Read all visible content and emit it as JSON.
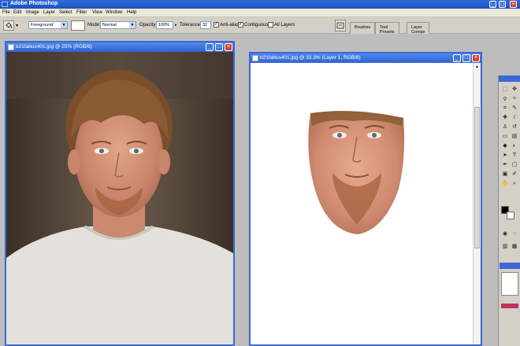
{
  "app": {
    "title": "Adobe Photoshop",
    "window_buttons": {
      "minimize": "_",
      "maximize": "□",
      "close": "×"
    }
  },
  "menu": [
    "File",
    "Edit",
    "Image",
    "Layer",
    "Select",
    "Filter",
    "View",
    "Window",
    "Help"
  ],
  "options": {
    "fill_source": "Foreground",
    "mode_label": "Mode:",
    "mode_value": "Normal",
    "opacity_label": "Opacity:",
    "opacity_value": "100%",
    "tolerance_label": "Tolerance:",
    "tolerance_value": "32",
    "anti_alias_label": "Anti-alias",
    "anti_alias_checked": true,
    "contiguous_label": "Contiguous",
    "contiguous_checked": true,
    "all_layers_label": "All Layers",
    "all_layers_checked": false
  },
  "palette_tabs": [
    "Brushes",
    "Tool Presets",
    "Layer Comps"
  ],
  "documents": [
    {
      "title": "b21fabus401.jpg @ 25% (RGB/8)"
    },
    {
      "title": "b21fabus401.jpg @ 33.3% (Layer 1, RGB/8)"
    }
  ],
  "colors": {
    "title_bar": "#2f6bd9",
    "menu_bg": "#ece9d8",
    "toolbar_bg": "#d4d0c8",
    "foreground_swatch": "#000000",
    "background_swatch": "#ffffff",
    "close_button": "#d8452b"
  },
  "icons": {
    "paint_bucket": "paint-bucket-icon",
    "palette_well": "palette-well-icon",
    "toolbox_tools": [
      "marquee-icon",
      "move-icon",
      "lasso-icon",
      "magic-wand-icon",
      "crop-icon",
      "slice-icon",
      "healing-brush-icon",
      "brush-icon",
      "clone-stamp-icon",
      "history-brush-icon",
      "eraser-icon",
      "gradient-icon",
      "blur-icon",
      "dodge-icon",
      "path-selection-icon",
      "type-icon",
      "pen-icon",
      "shape-icon",
      "notes-icon",
      "eyedropper-icon",
      "hand-icon",
      "zoom-icon"
    ]
  }
}
